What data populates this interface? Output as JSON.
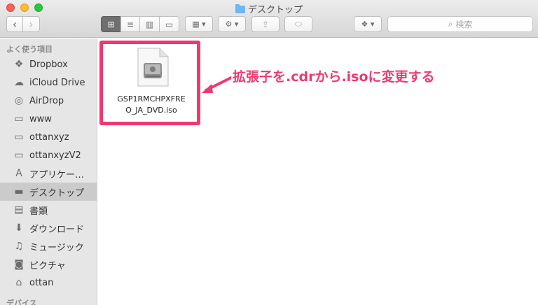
{
  "window": {
    "title": "デスクトップ"
  },
  "toolbar": {
    "back_label": "‹",
    "forward_label": "›",
    "view_icon_label": "⊞",
    "view_list_label": "≡",
    "view_column_label": "▥",
    "view_coverflow_label": "▭",
    "arrange_label": "▦ ▾",
    "action_label": "⚙ ▾",
    "share_label": "⇪",
    "tags_label": "⬭",
    "dropbox_label": "❖ ▾"
  },
  "search": {
    "placeholder": "検索",
    "icon": "magnifier-icon"
  },
  "sidebar": {
    "favorites_heading": "よく使う項目",
    "devices_heading": "デバイス",
    "items": [
      {
        "label": "Dropbox",
        "icon": "dropbox-icon"
      },
      {
        "label": "iCloud Drive",
        "icon": "cloud-icon"
      },
      {
        "label": "AirDrop",
        "icon": "airdrop-icon"
      },
      {
        "label": "www",
        "icon": "folder-icon"
      },
      {
        "label": "ottanxyz",
        "icon": "folder-icon"
      },
      {
        "label": "ottanxyzV2",
        "icon": "folder-icon"
      },
      {
        "label": "アプリケー…",
        "icon": "applications-icon"
      },
      {
        "label": "デスクトップ",
        "icon": "desktop-icon",
        "selected": true
      },
      {
        "label": "書類",
        "icon": "documents-icon"
      },
      {
        "label": "ダウンロード",
        "icon": "download-icon"
      },
      {
        "label": "ミュージック",
        "icon": "music-icon"
      },
      {
        "label": "ピクチャ",
        "icon": "camera-icon"
      },
      {
        "label": "ottan",
        "icon": "home-icon"
      }
    ]
  },
  "file": {
    "name_line1": "GSP1RMCHPXFRE",
    "name_line2": "O_JA_DVD.iso",
    "icon": "disk-image-icon"
  },
  "annotation": {
    "text": "拡張子を.cdrから.isoに変更する",
    "color": "#f0386e"
  }
}
